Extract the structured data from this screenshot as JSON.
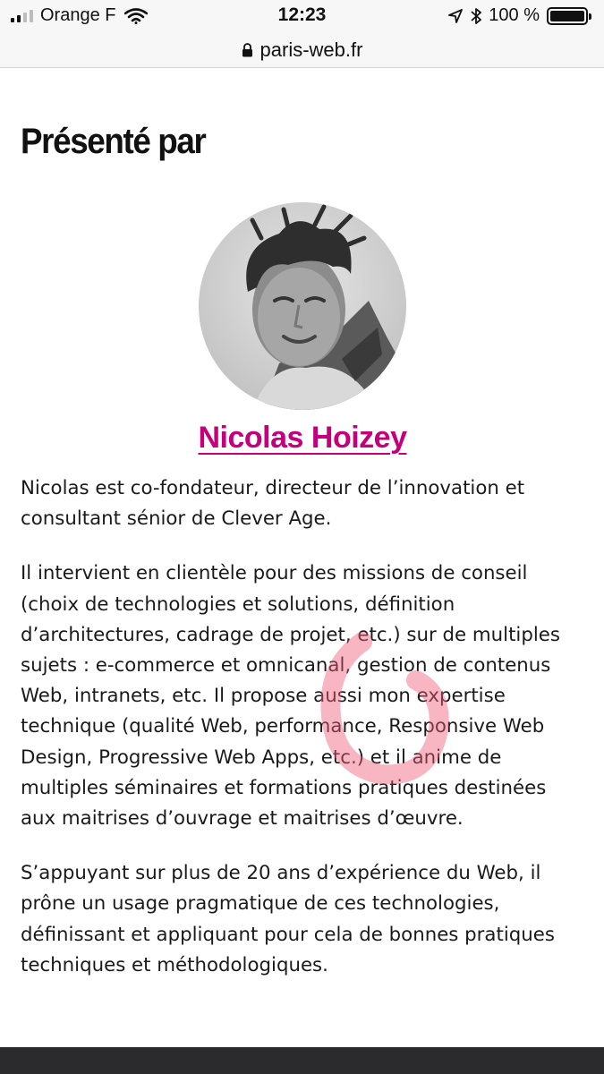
{
  "status_bar": {
    "carrier": "Orange F",
    "time": "12:23",
    "battery": "100 %",
    "icons": [
      "signal-icon",
      "wifi-icon",
      "location-arrow-icon",
      "bluetooth-icon",
      "battery-icon"
    ]
  },
  "browser": {
    "url": "paris-web.fr"
  },
  "section": {
    "title": "Présenté par"
  },
  "speaker": {
    "name": "Nicolas Hoizey",
    "link_color": "#c4007a"
  },
  "bio": {
    "paragraphs": [
      [
        "Nicolas est co-fondateur, directeur de l’innovation et",
        "consultant sénior de Clever Age."
      ],
      [
        "Il intervient en clientèle pour des missions de conseil",
        "(choix de technologies et solutions, définition",
        "d’architectures, cadrage de projet, etc.) sur de multiples",
        "sujets : e-commerce et omnicanal, gestion de contenus",
        "Web, intranets, etc. Il propose aussi mon expertise",
        "technique (qualité Web, performance, Responsive Web",
        "Design, Progressive Web Apps, etc.) et il anime de",
        "multiples séminaires et formations pratiques destinées",
        "aux maitrises d’ouvrage et maitrises d’œuvre."
      ],
      [
        "S’appuyant sur plus de 20 ans d’expérience du Web, il",
        "prône un usage pragmatique de ces technologies,",
        "définissant et appliquant pour cela de bonnes pratiques",
        "techniques et méthodologiques."
      ]
    ]
  },
  "colors": {
    "annotation": "#f05a78",
    "footer": "#2b2b2e"
  }
}
